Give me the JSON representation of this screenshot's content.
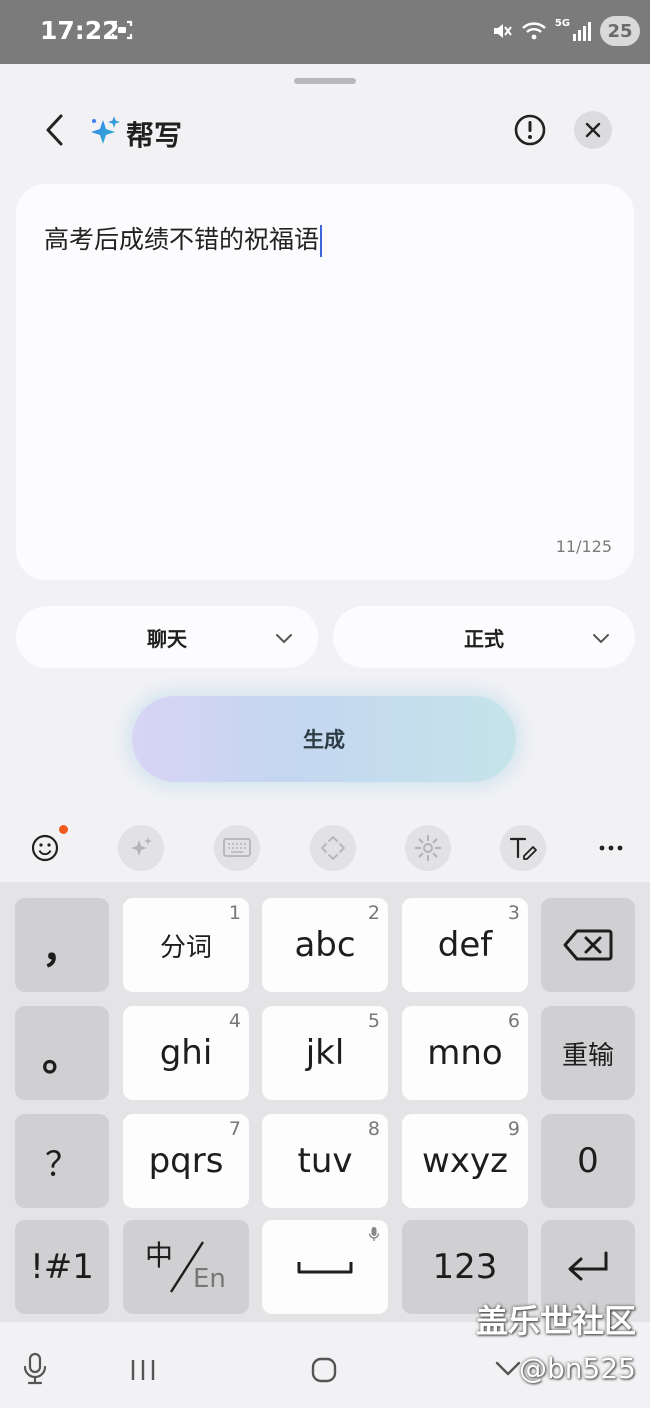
{
  "status_bar": {
    "time": "17:22",
    "network_label": "5G",
    "battery": "25"
  },
  "header": {
    "title": "帮写"
  },
  "editor": {
    "text": "高考后成绩不错的祝福语",
    "char_count": "11/125"
  },
  "options": {
    "scene": "聊天",
    "tone": "正式"
  },
  "generate_label": "生成",
  "keyboard": {
    "row1": [
      {
        "label": "，"
      },
      {
        "label": "分词",
        "num": "1"
      },
      {
        "label": "abc",
        "num": "2"
      },
      {
        "label": "def",
        "num": "3"
      }
    ],
    "row2": [
      {
        "label": "。"
      },
      {
        "label": "ghi",
        "num": "4"
      },
      {
        "label": "jkl",
        "num": "5"
      },
      {
        "label": "mno",
        "num": "6"
      },
      {
        "label": "重输"
      }
    ],
    "row3": [
      {
        "label": "？"
      },
      {
        "label": "pqrs",
        "num": "7"
      },
      {
        "label": "tuv",
        "num": "8"
      },
      {
        "label": "wxyz",
        "num": "9"
      },
      {
        "label": "0"
      }
    ],
    "row4": [
      {
        "label": "!#1"
      },
      {
        "label_cn": "中",
        "label_en": "En"
      },
      {
        "label": "123"
      }
    ]
  },
  "watermark": {
    "line1": "盖乐世社区",
    "line2": "@bn525"
  },
  "colors": {
    "accent_caret": "#3f63d8",
    "notification_dot": "#f05a1e"
  }
}
